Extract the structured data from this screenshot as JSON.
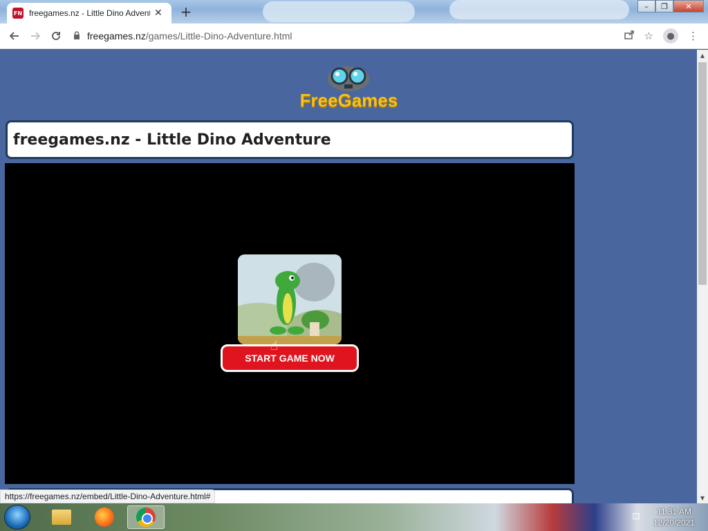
{
  "browser": {
    "tab_title": "freegames.nz - Little Dino Adventure",
    "tab_favicon_text": "FN",
    "tab_close": "✕",
    "new_tab": "+",
    "url_domain": "freegames.nz",
    "url_path": "/games/Little-Dino-Adventure.html",
    "icons": [
      "back-icon",
      "forward-icon",
      "reload-icon",
      "lock-icon",
      "share-icon",
      "star-icon",
      "profile-icon",
      "menu-icon"
    ]
  },
  "window_controls": {
    "minimize": "–",
    "restore": "❐",
    "close": "✕"
  },
  "page": {
    "logo_text": "FreeGames",
    "title": "freegames.nz - Little Dino Adventure",
    "start_button": "START GAME NOW",
    "status_link": "https://freegames.nz/embed/Little-Dino-Adventure.html#"
  },
  "taskbar": {
    "time": "11:31 AM",
    "date": "12/20/2021"
  }
}
